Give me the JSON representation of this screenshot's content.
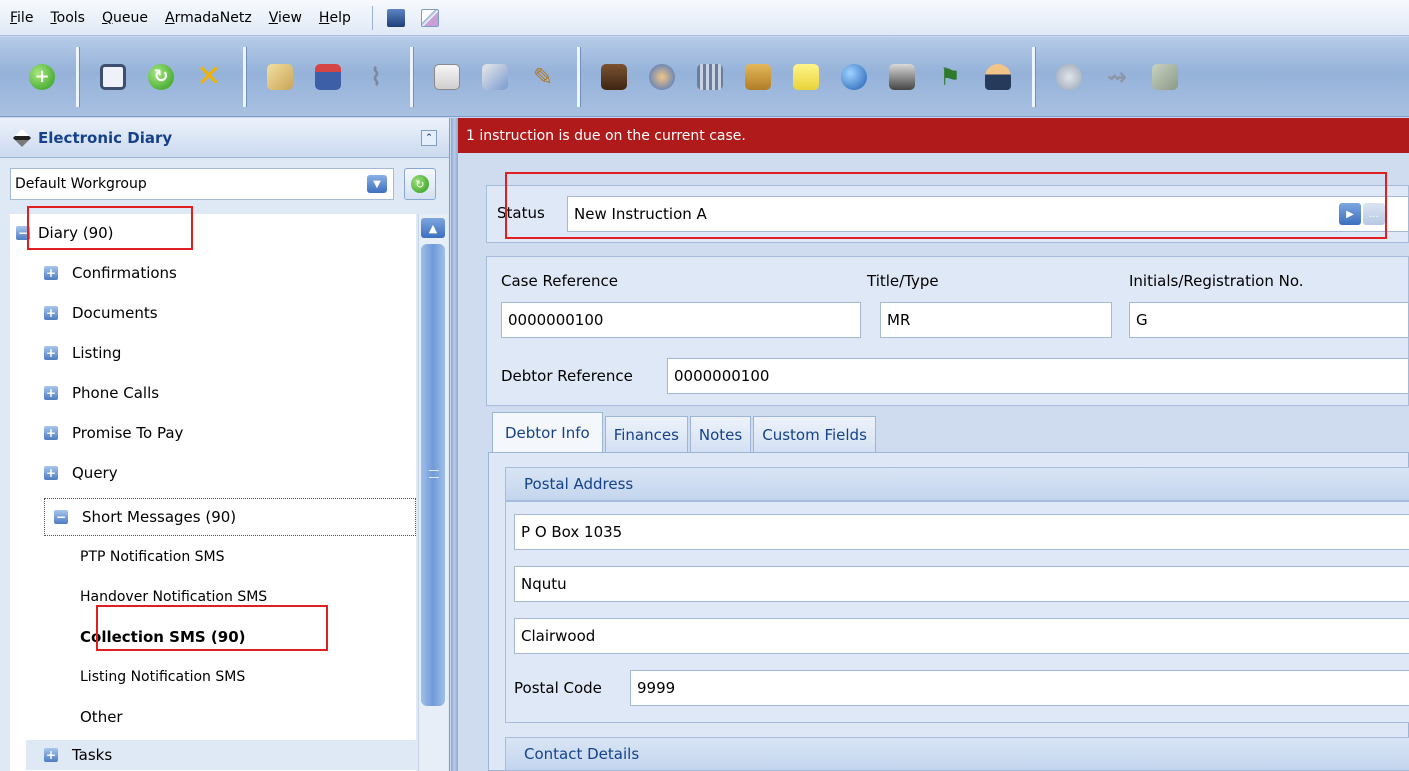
{
  "menu": {
    "items": [
      {
        "label": "File",
        "accel": "F",
        "rest": "ile"
      },
      {
        "label": "Tools",
        "accel": "T",
        "rest": "ools"
      },
      {
        "label": "Queue",
        "accel": "Q",
        "rest": "ueue"
      },
      {
        "label": "ArmadaNetz",
        "accel": "A",
        "rest": "rmadaNetz"
      },
      {
        "label": "View",
        "accel": "V",
        "rest": "iew"
      },
      {
        "label": "Help",
        "accel": "H",
        "rest": "elp"
      }
    ]
  },
  "toolbar": {
    "groups": [
      [
        "add-icon"
      ],
      [
        "save-icon",
        "refresh-icon",
        "cancel-icon"
      ],
      [
        "scroll-icon",
        "book-icon",
        "paperclip-icon"
      ],
      [
        "calculator-icon",
        "documents-icon",
        "signature-icon"
      ],
      [
        "stamp-icon",
        "users-icon",
        "files-icon",
        "package-icon",
        "note-icon",
        "globe-icon",
        "printer-icon",
        "flag-icon",
        "agent-icon"
      ],
      [
        "search-disabled-icon",
        "view-disabled-icon",
        "tools-disabled-icon"
      ]
    ]
  },
  "left_panel": {
    "title": "Electronic Diary",
    "workgroup": "Default Workgroup",
    "tree": {
      "root": "Diary (90)",
      "items": [
        "Confirmations",
        "Documents",
        "Listing",
        "Phone Calls",
        "Promise To Pay",
        "Query",
        "Short Messages (90)"
      ],
      "sms_children": [
        "PTP Notification SMS",
        "Handover Notification SMS",
        "Collection SMS (90)",
        "Listing Notification SMS",
        "Other"
      ],
      "after": "Tasks"
    }
  },
  "alert": {
    "message": "1 instruction is due on the current case."
  },
  "status": {
    "label": "Status",
    "value": "New Instruction A"
  },
  "case": {
    "case_reference_label": "Case Reference",
    "case_reference": "0000000100",
    "title_type_label": "Title/Type",
    "title_type": "MR",
    "initials_label": "Initials/Registration No.",
    "initials": "G",
    "debtor_reference_label": "Debtor Reference",
    "debtor_reference": "0000000100"
  },
  "tabs": [
    "Debtor Info",
    "Finances",
    "Notes",
    "Custom Fields"
  ],
  "postal": {
    "header": "Postal Address",
    "line1": "P O Box 1035",
    "line2": "Nqutu",
    "line3": "Clairwood",
    "postal_code_label": "Postal Code",
    "postal_code": "9999"
  },
  "contact": {
    "header": "Contact Details"
  },
  "colors": {
    "alert": "#b11a1a",
    "highlight_box": "#e02020",
    "header_text": "#15428b"
  }
}
